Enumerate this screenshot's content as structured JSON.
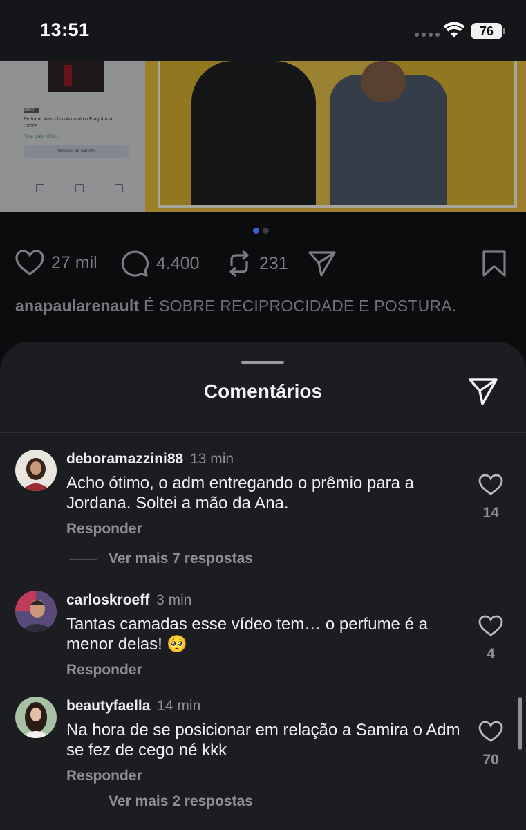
{
  "status_bar": {
    "time": "13:51",
    "battery": "76"
  },
  "post": {
    "product": {
      "tag": "VIDEO",
      "title": "Perfume Masculino Aromático Fragrância Cítrica",
      "shipping": "Frete grátis ⚡FULL",
      "button": "Adicionar ao carrinho"
    },
    "likes": "27 mil",
    "comments": "4.400",
    "reposts": "231",
    "caption_user": "anapaularenault",
    "caption_text": "É SOBRE RECIPROCIDADE E POSTURA."
  },
  "sheet": {
    "title": "Comentários",
    "comments": [
      {
        "user": "deboramazzini88",
        "time": "13 min",
        "text": "Acho ótimo, o adm entregando o prêmio para a Jordana. Soltei a mão da Ana.",
        "reply": "Responder",
        "likes": "14",
        "more": "Ver mais 7 respostas"
      },
      {
        "user": "carloskroeff",
        "time": "3 min",
        "text": "Tantas camadas esse vídeo tem… o perfume é a menor delas! 🥺",
        "reply": "Responder",
        "likes": "4"
      },
      {
        "user": "beautyfaella",
        "time": "14 min",
        "text": "Na hora de se posicionar em relação a Samira o Adm se fez de cego né kkk",
        "reply": "Responder",
        "likes": "70",
        "more": "Ver mais 2 respostas"
      }
    ]
  },
  "colors": {
    "sheet_bg": "#1b1d21",
    "accent_dot": "#3f5fd0"
  }
}
